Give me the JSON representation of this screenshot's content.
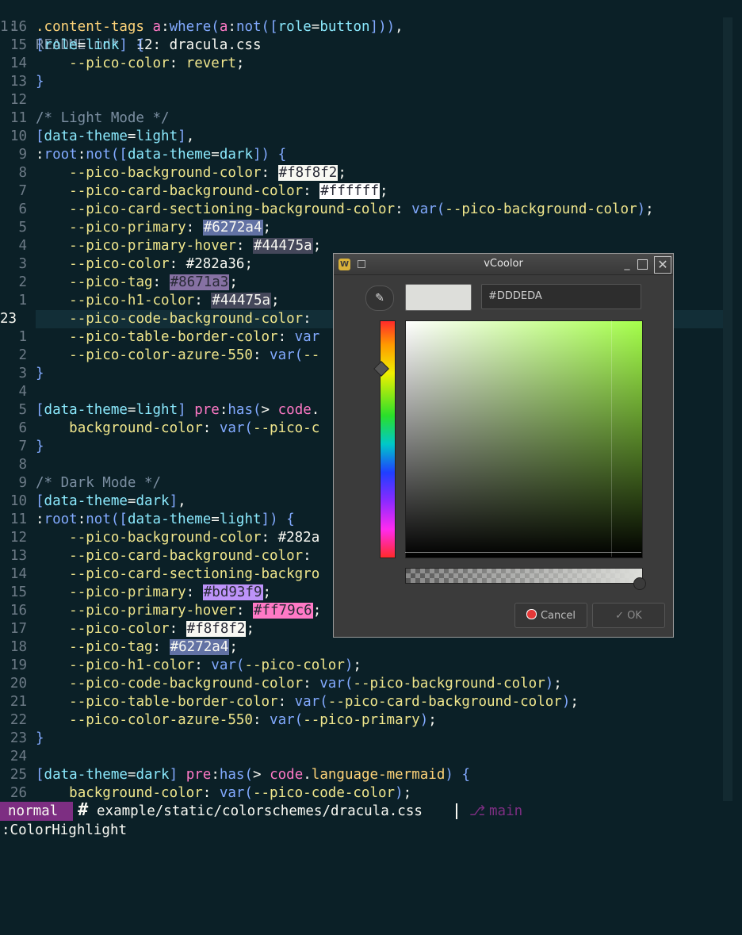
{
  "tabline": {
    "lnum": "1:",
    "tab1": "README.md*",
    "tab2": "12: dracula.css"
  },
  "lines": [
    {
      "n": "16",
      "parts": [
        [
          "sel",
          ".content-tags "
        ],
        [
          "kw",
          "a"
        ],
        [
          "pl",
          ":"
        ],
        [
          "fn",
          "where"
        ],
        [
          "br",
          "("
        ],
        [
          "kw",
          "a"
        ],
        [
          "pl",
          ":"
        ],
        [
          "fn",
          "not"
        ],
        [
          "br",
          "(["
        ],
        [
          "attr",
          "role"
        ],
        [
          "pl",
          "="
        ],
        [
          "attr",
          "button"
        ],
        [
          "br",
          "]))"
        ],
        [
          "pl",
          ","
        ]
      ]
    },
    {
      "n": "15",
      "parts": [
        [
          "br",
          "["
        ],
        [
          "attr",
          "role"
        ],
        [
          "pl",
          "="
        ],
        [
          "attr",
          "link"
        ],
        [
          "br",
          "]"
        ],
        [
          "pl",
          " "
        ],
        [
          "br",
          "{"
        ]
      ]
    },
    {
      "n": "14",
      "parts": [
        [
          "pl",
          "    "
        ],
        [
          "prop",
          "--pico-color"
        ],
        [
          "pl",
          ": "
        ],
        [
          "var",
          "revert"
        ],
        [
          "pl",
          ";"
        ]
      ]
    },
    {
      "n": "13",
      "parts": [
        [
          "br",
          "}"
        ]
      ]
    },
    {
      "n": "12",
      "parts": []
    },
    {
      "n": "11",
      "parts": [
        [
          "cm",
          "/* Light Mode */"
        ]
      ]
    },
    {
      "n": "10",
      "parts": [
        [
          "br",
          "["
        ],
        [
          "attr",
          "data-theme"
        ],
        [
          "pl",
          "="
        ],
        [
          "attr",
          "light"
        ],
        [
          "br",
          "]"
        ],
        [
          "pl",
          ","
        ]
      ]
    },
    {
      "n": "9",
      "parts": [
        [
          "pl",
          ":"
        ],
        [
          "fn",
          "root"
        ],
        [
          "pl",
          ":"
        ],
        [
          "fn",
          "not"
        ],
        [
          "br",
          "(["
        ],
        [
          "attr",
          "data-theme"
        ],
        [
          "pl",
          "="
        ],
        [
          "attr",
          "dark"
        ],
        [
          "br",
          "])"
        ],
        [
          "pl",
          " "
        ],
        [
          "br",
          "{"
        ]
      ]
    },
    {
      "n": "8",
      "parts": [
        [
          "pl",
          "    "
        ],
        [
          "prop",
          "--pico-background-color"
        ],
        [
          "pl",
          ": "
        ],
        [
          "sw:#f8f8f2:#282a36",
          "#f8f8f2"
        ],
        [
          "pl",
          ";"
        ]
      ]
    },
    {
      "n": "7",
      "parts": [
        [
          "pl",
          "    "
        ],
        [
          "prop",
          "--pico-card-background-color"
        ],
        [
          "pl",
          ": "
        ],
        [
          "sw:#ffffff:#282a36",
          "#ffffff"
        ],
        [
          "pl",
          ";"
        ]
      ]
    },
    {
      "n": "6",
      "parts": [
        [
          "pl",
          "    "
        ],
        [
          "prop",
          "--pico-card-sectioning-background-color"
        ],
        [
          "pl",
          ": "
        ],
        [
          "fn",
          "var"
        ],
        [
          "br",
          "("
        ],
        [
          "prop",
          "--pico-background-color"
        ],
        [
          "br",
          ")"
        ],
        [
          "pl",
          ";"
        ]
      ]
    },
    {
      "n": "5",
      "parts": [
        [
          "pl",
          "    "
        ],
        [
          "prop",
          "--pico-primary"
        ],
        [
          "pl",
          ": "
        ],
        [
          "sw:#6272a4:#f8f8f2",
          "#6272a4"
        ],
        [
          "pl",
          ";"
        ]
      ]
    },
    {
      "n": "4",
      "parts": [
        [
          "pl",
          "    "
        ],
        [
          "prop",
          "--pico-primary-hover"
        ],
        [
          "pl",
          ": "
        ],
        [
          "sw:#44475a:#f8f8f2",
          "#44475a"
        ],
        [
          "pl",
          ";"
        ]
      ]
    },
    {
      "n": "3",
      "parts": [
        [
          "pl",
          "    "
        ],
        [
          "prop",
          "--pico-color"
        ],
        [
          "pl",
          ": "
        ],
        [
          "pl",
          "#282a36"
        ],
        [
          "pl",
          ";"
        ]
      ]
    },
    {
      "n": "2",
      "parts": [
        [
          "pl",
          "    "
        ],
        [
          "prop",
          "--pico-tag"
        ],
        [
          "pl",
          ": "
        ],
        [
          "sw:#8671a3:#282a36",
          "#8671a3"
        ],
        [
          "pl",
          ";"
        ]
      ]
    },
    {
      "n": "1",
      "parts": [
        [
          "pl",
          "    "
        ],
        [
          "prop",
          "--pico-h1-color"
        ],
        [
          "pl",
          ": "
        ],
        [
          "sw:#44475a:#f8f8f2",
          "#44475a"
        ],
        [
          "pl",
          ";"
        ]
      ]
    },
    {
      "n": "23",
      "cur": true,
      "parts": [
        [
          "pl",
          "    "
        ],
        [
          "prop",
          "--pico-code-background-color"
        ],
        [
          "pl",
          ":"
        ]
      ]
    },
    {
      "n": "1",
      "parts": [
        [
          "pl",
          "    "
        ],
        [
          "prop",
          "--pico-table-border-color"
        ],
        [
          "pl",
          ": "
        ],
        [
          "fn",
          "var"
        ]
      ]
    },
    {
      "n": "2",
      "parts": [
        [
          "pl",
          "    "
        ],
        [
          "prop",
          "--pico-color-azure-550"
        ],
        [
          "pl",
          ": "
        ],
        [
          "fn",
          "var"
        ],
        [
          "br",
          "("
        ],
        [
          "prop",
          "--"
        ]
      ]
    },
    {
      "n": "3",
      "parts": [
        [
          "br",
          "}"
        ]
      ]
    },
    {
      "n": "4",
      "parts": []
    },
    {
      "n": "5",
      "parts": [
        [
          "br",
          "["
        ],
        [
          "attr",
          "data-theme"
        ],
        [
          "pl",
          "="
        ],
        [
          "attr",
          "light"
        ],
        [
          "br",
          "]"
        ],
        [
          "pl",
          " "
        ],
        [
          "kw",
          "pre"
        ],
        [
          "pl",
          ":"
        ],
        [
          "fn",
          "has"
        ],
        [
          "br",
          "("
        ],
        [
          "pl",
          "> "
        ],
        [
          "kw",
          "code"
        ],
        [
          "pl",
          "."
        ]
      ]
    },
    {
      "n": "6",
      "parts": [
        [
          "pl",
          "    "
        ],
        [
          "prop",
          "background-color"
        ],
        [
          "pl",
          ": "
        ],
        [
          "fn",
          "var"
        ],
        [
          "br",
          "("
        ],
        [
          "prop",
          "--pico-c"
        ]
      ]
    },
    {
      "n": "7",
      "parts": [
        [
          "br",
          "}"
        ]
      ]
    },
    {
      "n": "8",
      "parts": []
    },
    {
      "n": "9",
      "parts": [
        [
          "cm",
          "/* Dark Mode */"
        ]
      ]
    },
    {
      "n": "10",
      "parts": [
        [
          "br",
          "["
        ],
        [
          "attr",
          "data-theme"
        ],
        [
          "pl",
          "="
        ],
        [
          "attr",
          "dark"
        ],
        [
          "br",
          "]"
        ],
        [
          "pl",
          ","
        ]
      ]
    },
    {
      "n": "11",
      "parts": [
        [
          "pl",
          ":"
        ],
        [
          "fn",
          "root"
        ],
        [
          "pl",
          ":"
        ],
        [
          "fn",
          "not"
        ],
        [
          "br",
          "(["
        ],
        [
          "attr",
          "data-theme"
        ],
        [
          "pl",
          "="
        ],
        [
          "attr",
          "light"
        ],
        [
          "br",
          "])"
        ],
        [
          "pl",
          " "
        ],
        [
          "br",
          "{"
        ]
      ]
    },
    {
      "n": "12",
      "parts": [
        [
          "pl",
          "    "
        ],
        [
          "prop",
          "--pico-background-color"
        ],
        [
          "pl",
          ": "
        ],
        [
          "pl",
          "#282a"
        ]
      ]
    },
    {
      "n": "13",
      "parts": [
        [
          "pl",
          "    "
        ],
        [
          "prop",
          "--pico-card-background-color"
        ],
        [
          "pl",
          ":"
        ]
      ]
    },
    {
      "n": "14",
      "parts": [
        [
          "pl",
          "    "
        ],
        [
          "prop",
          "--pico-card-sectioning-backgro"
        ],
        [
          "pl",
          "                                      ;"
        ]
      ]
    },
    {
      "n": "15",
      "parts": [
        [
          "pl",
          "    "
        ],
        [
          "prop",
          "--pico-primary"
        ],
        [
          "pl",
          ": "
        ],
        [
          "sw:#bd93f9:#282a36",
          "#bd93f9"
        ],
        [
          "pl",
          ";"
        ]
      ]
    },
    {
      "n": "16",
      "parts": [
        [
          "pl",
          "    "
        ],
        [
          "prop",
          "--pico-primary-hover"
        ],
        [
          "pl",
          ": "
        ],
        [
          "sw:#ff79c6:#282a36",
          "#ff79c6"
        ],
        [
          "pl",
          ";"
        ]
      ]
    },
    {
      "n": "17",
      "parts": [
        [
          "pl",
          "    "
        ],
        [
          "prop",
          "--pico-color"
        ],
        [
          "pl",
          ": "
        ],
        [
          "sw:#f8f8f2:#282a36",
          "#f8f8f2"
        ],
        [
          "pl",
          ";"
        ]
      ]
    },
    {
      "n": "18",
      "parts": [
        [
          "pl",
          "    "
        ],
        [
          "prop",
          "--pico-tag"
        ],
        [
          "pl",
          ": "
        ],
        [
          "sw:#6272a4:#f8f8f2",
          "#6272a4"
        ],
        [
          "pl",
          ";"
        ]
      ]
    },
    {
      "n": "19",
      "parts": [
        [
          "pl",
          "    "
        ],
        [
          "prop",
          "--pico-h1-color"
        ],
        [
          "pl",
          ": "
        ],
        [
          "fn",
          "var"
        ],
        [
          "br",
          "("
        ],
        [
          "prop",
          "--pico-color"
        ],
        [
          "br",
          ")"
        ],
        [
          "pl",
          ";"
        ]
      ]
    },
    {
      "n": "20",
      "parts": [
        [
          "pl",
          "    "
        ],
        [
          "prop",
          "--pico-code-background-color"
        ],
        [
          "pl",
          ": "
        ],
        [
          "fn",
          "var"
        ],
        [
          "br",
          "("
        ],
        [
          "prop",
          "--pico-background-color"
        ],
        [
          "br",
          ")"
        ],
        [
          "pl",
          ";"
        ]
      ]
    },
    {
      "n": "21",
      "parts": [
        [
          "pl",
          "    "
        ],
        [
          "prop",
          "--pico-table-border-color"
        ],
        [
          "pl",
          ": "
        ],
        [
          "fn",
          "var"
        ],
        [
          "br",
          "("
        ],
        [
          "prop",
          "--pico-card-background-color"
        ],
        [
          "br",
          ")"
        ],
        [
          "pl",
          ";"
        ]
      ]
    },
    {
      "n": "22",
      "parts": [
        [
          "pl",
          "    "
        ],
        [
          "prop",
          "--pico-color-azure-550"
        ],
        [
          "pl",
          ": "
        ],
        [
          "fn",
          "var"
        ],
        [
          "br",
          "("
        ],
        [
          "prop",
          "--pico-primary"
        ],
        [
          "br",
          ")"
        ],
        [
          "pl",
          ";"
        ]
      ]
    },
    {
      "n": "23",
      "parts": [
        [
          "br",
          "}"
        ]
      ]
    },
    {
      "n": "24",
      "parts": []
    },
    {
      "n": "25",
      "parts": [
        [
          "br",
          "["
        ],
        [
          "attr",
          "data-theme"
        ],
        [
          "pl",
          "="
        ],
        [
          "attr",
          "dark"
        ],
        [
          "br",
          "]"
        ],
        [
          "pl",
          " "
        ],
        [
          "kw",
          "pre"
        ],
        [
          "pl",
          ":"
        ],
        [
          "fn",
          "has"
        ],
        [
          "br",
          "("
        ],
        [
          "pl",
          "> "
        ],
        [
          "kw",
          "code"
        ],
        [
          "pl",
          "."
        ],
        [
          "sel",
          "language-mermaid"
        ],
        [
          "br",
          ")"
        ],
        [
          "pl",
          " "
        ],
        [
          "br",
          "{"
        ]
      ]
    },
    {
      "n": "26",
      "parts": [
        [
          "pl",
          "    "
        ],
        [
          "prop",
          "background-color"
        ],
        [
          "pl",
          ": "
        ],
        [
          "fn",
          "var"
        ],
        [
          "br",
          "("
        ],
        [
          "prop",
          "--pico-code-color"
        ],
        [
          "br",
          ")"
        ],
        [
          "pl",
          ";"
        ]
      ]
    }
  ],
  "status": {
    "mode": "normal",
    "hash": "#",
    "file": "example/static/colorschemes/dracula.css",
    "branch_icon": "⎇",
    "branch": "main"
  },
  "cmdline": ":ColorHighlight",
  "dialog": {
    "app_icon": "W",
    "title": "vCoolor",
    "min": "_",
    "close": "✕",
    "hex": "#DDDEDA",
    "picker_icon": "✎",
    "preview_color": "#dddeda",
    "cancel": "Cancel",
    "ok_icon": "✓",
    "ok": "OK"
  }
}
